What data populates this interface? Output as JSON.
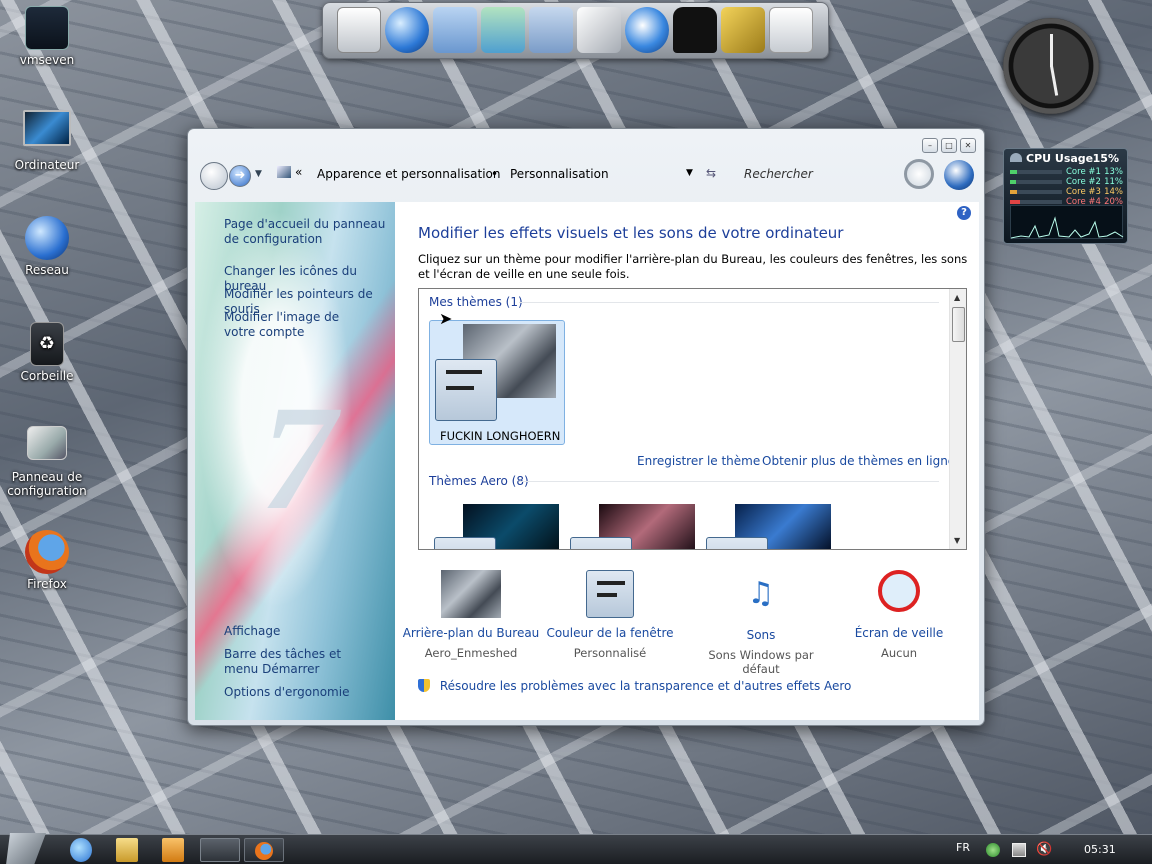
{
  "desktop": {
    "icons": [
      {
        "label": "vmseven"
      },
      {
        "label": "Ordinateur"
      },
      {
        "label": "Reseau"
      },
      {
        "label": "Corbeille"
      },
      {
        "label": "Panneau de configuration"
      },
      {
        "label": "Firefox"
      }
    ]
  },
  "cpu_gadget": {
    "title": "CPU Usage",
    "total": "15%",
    "cores": [
      {
        "label": "Core #1",
        "pct": "13%",
        "fraction": 0.13,
        "color": "#4fd06a"
      },
      {
        "label": "Core #2",
        "pct": "11%",
        "fraction": 0.11,
        "color": "#4fd06a"
      },
      {
        "label": "Core #3",
        "pct": "14%",
        "fraction": 0.14,
        "color": "#e2a33a"
      },
      {
        "label": "Core #4",
        "pct": "20%",
        "fraction": 0.2,
        "color": "#e04444"
      }
    ]
  },
  "window": {
    "breadcrumb": {
      "chevron": "«",
      "part1": "Apparence et personnalisation",
      "separator": "•",
      "part2": "Personnalisation"
    },
    "search_placeholder": "Rechercher",
    "left_pane": {
      "home_link": "Page d'accueil du panneau de configuration",
      "links": [
        "Changer les icônes du bureau",
        "Modifier les pointeurs de souris",
        "Modifier l'image de votre compte"
      ],
      "see_also": [
        "Affichage",
        "Barre des tâches et menu Démarrer",
        "Options d'ergonomie"
      ],
      "decoration": "7"
    },
    "main": {
      "heading": "Modifier les effets visuels et les sons de votre ordinateur",
      "description": "Cliquez sur un thème pour modifier l'arrière-plan du Bureau, les couleurs des fenêtres, les sons et l'écran de veille en une seule fois.",
      "my_themes_label": "Mes thèmes (1)",
      "selected_theme": "FUCKIN LONGHOERN",
      "save_theme_link": "Enregistrer le thème",
      "more_themes_link": "Obtenir plus de thèmes en ligne",
      "aero_themes_label": "Thèmes Aero (8)",
      "bottom": [
        {
          "label": "Arrière-plan du Bureau",
          "value": "Aero_Enmeshed"
        },
        {
          "label": "Couleur de la fenêtre",
          "value": "Personnalisé"
        },
        {
          "label": "Sons",
          "value": "Sons Windows par défaut"
        },
        {
          "label": "Écran de veille",
          "value": "Aucun"
        }
      ],
      "troubleshoot_link": "Résoudre les problèmes avec la transparence et d'autres effets Aero"
    }
  },
  "taskbar": {
    "language": "FR",
    "clock": "05:31"
  }
}
